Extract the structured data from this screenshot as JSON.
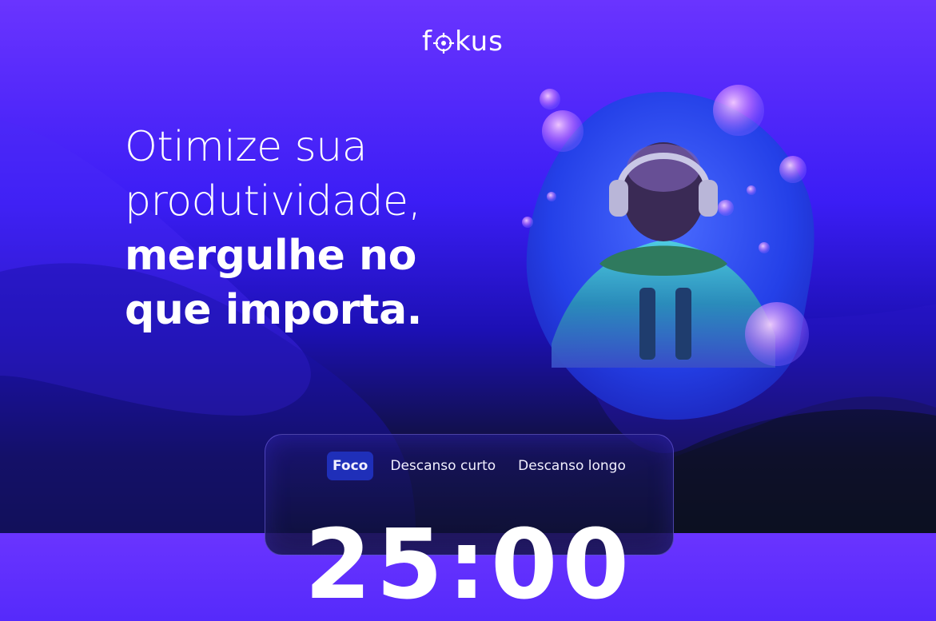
{
  "brand": {
    "logo_text": "fokus"
  },
  "hero": {
    "line1": "Otimize sua",
    "line2": "produtividade,",
    "line3": "mergulhe no",
    "line4": "que importa."
  },
  "timer_card": {
    "tabs": [
      {
        "label": "Foco",
        "active": true
      },
      {
        "label": "Descanso curto",
        "active": false
      },
      {
        "label": "Descanso longo",
        "active": false
      }
    ],
    "time": "25:00"
  },
  "colors": {
    "accent": "#1f2fb9",
    "bg_top": "#6a34ff",
    "bg_bottom": "#0b0f1b"
  }
}
